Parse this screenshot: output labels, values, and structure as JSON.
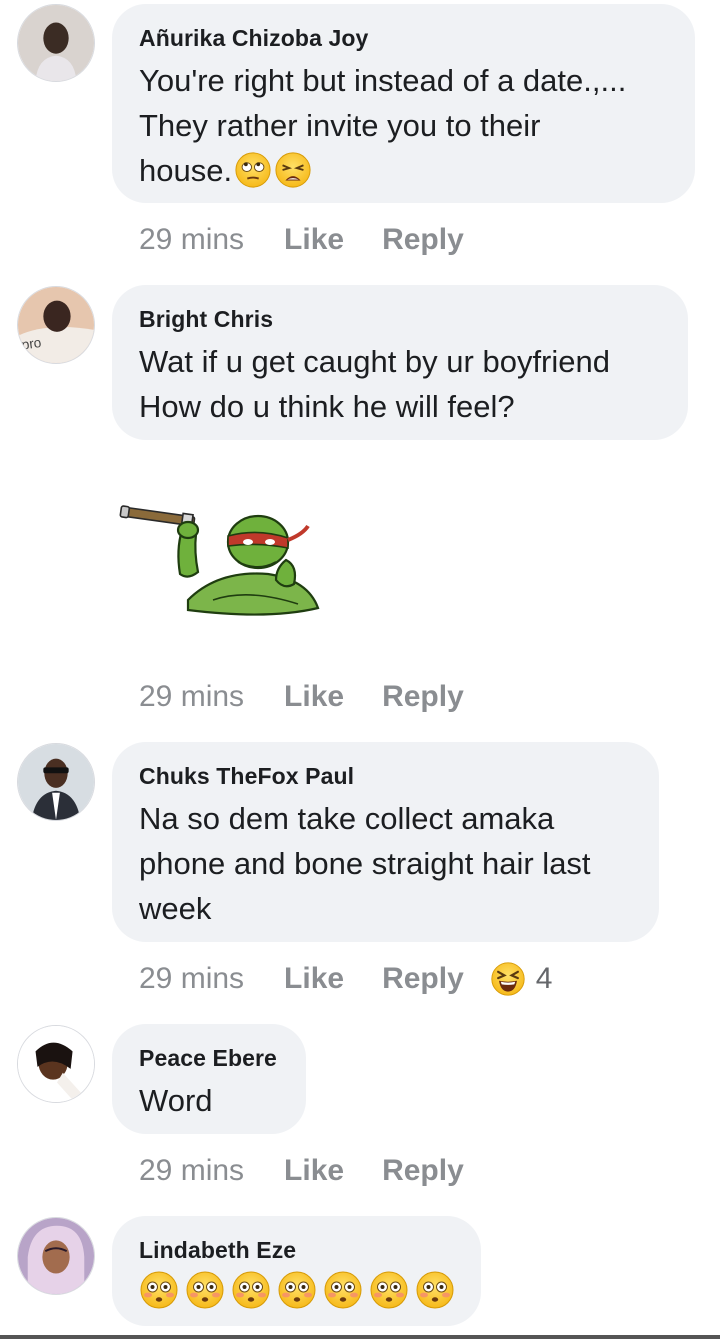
{
  "comments": [
    {
      "author": "Añurika Chizoba Joy",
      "line1": "You're right but instead of a date.,...",
      "line2": "They rather invite you to their",
      "line3": "house.",
      "emojis": [
        "rolling-eyes-icon",
        "weary-face-icon"
      ],
      "time": "29 mins",
      "like": "Like",
      "reply": "Reply"
    },
    {
      "author": "Bright Chris",
      "line1": "Wat if u get caught by ur boyfriend",
      "line2": "How do u think he will feel?",
      "sticker": "turtle-telescope-sticker",
      "time": "29 mins",
      "like": "Like",
      "reply": "Reply"
    },
    {
      "author": "Chuks TheFox Paul",
      "line1": "Na so dem take collect amaka",
      "line2": "phone and bone straight hair last",
      "line3": "week",
      "time": "29 mins",
      "like": "Like",
      "reply": "Reply",
      "reaction_icon": "laughing-squint-icon",
      "reaction_count": "4"
    },
    {
      "author": "Peace Ebere",
      "line1": "Word",
      "time": "29 mins",
      "like": "Like",
      "reply": "Reply"
    },
    {
      "author": "Lindabeth Eze",
      "emojis": [
        "flushed-face-icon",
        "flushed-face-icon",
        "flushed-face-icon",
        "flushed-face-icon",
        "flushed-face-icon",
        "flushed-face-icon",
        "flushed-face-icon"
      ]
    }
  ],
  "colors": {
    "bubble_bg": "#f0f2f5",
    "meta_text": "#8a8d91",
    "text": "#1c1e21"
  }
}
